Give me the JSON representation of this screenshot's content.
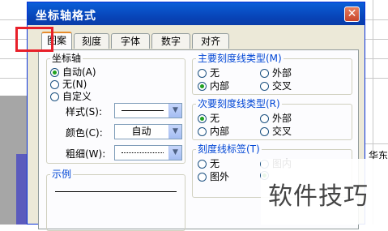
{
  "dialog": {
    "title": "坐标轴格式",
    "close_symbol": "✕"
  },
  "tabs": [
    {
      "label": "图案",
      "active": true
    },
    {
      "label": "刻度",
      "active": false
    },
    {
      "label": "字体",
      "active": false
    },
    {
      "label": "数字",
      "active": false
    },
    {
      "label": "对齐",
      "active": false
    }
  ],
  "axis": {
    "title": "坐标轴",
    "options": [
      {
        "label": "自动(A)",
        "selected": true
      },
      {
        "label": "无(N)",
        "selected": false
      },
      {
        "label": "自定义",
        "selected": false
      }
    ],
    "style_label": "样式(S):",
    "color_label": "颜色(C):",
    "color_value": "自动",
    "weight_label": "粗细(W):"
  },
  "major_tick": {
    "title": "主要刻度线类型(M)",
    "options": [
      {
        "label": "无",
        "selected": false
      },
      {
        "label": "外部",
        "selected": false
      },
      {
        "label": "内部",
        "selected": true
      },
      {
        "label": "交叉",
        "selected": false
      }
    ]
  },
  "minor_tick": {
    "title": "次要刻度线类型(R)",
    "options": [
      {
        "label": "无",
        "selected": true
      },
      {
        "label": "外部",
        "selected": false
      },
      {
        "label": "内部",
        "selected": false
      },
      {
        "label": "交叉",
        "selected": false
      }
    ]
  },
  "tick_labels": {
    "title": "刻度线标签(T)",
    "options": [
      {
        "label": "无",
        "selected": false
      },
      {
        "label": "图内",
        "selected": false
      },
      {
        "label": "图外",
        "selected": false
      }
    ]
  },
  "sample": {
    "title": "示例"
  },
  "background": {
    "cell_text": "华东"
  },
  "watermark": {
    "text": "软件技巧"
  },
  "colors": {
    "titlebar": "#0a5fd8",
    "highlight_box": "#e8202a",
    "radio_selected": "#21a121"
  }
}
